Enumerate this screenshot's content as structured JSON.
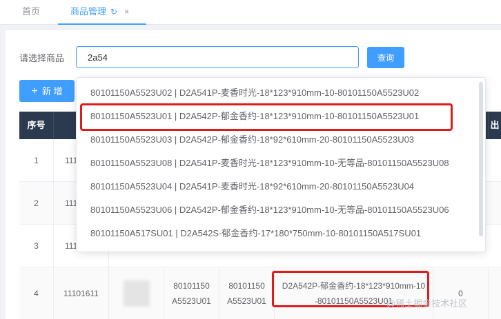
{
  "tabs": {
    "home": "首页",
    "active": "商品管理",
    "refresh_icon": "↻",
    "close_icon": "×"
  },
  "filter": {
    "label": "请选择商品",
    "value": "2a54",
    "query_button": "查询"
  },
  "toolbar": {
    "add_label": "新 增",
    "add_icon": "+"
  },
  "table": {
    "headers": [
      "序号",
      "",
      "",
      "",
      "",
      "",
      "",
      "出"
    ],
    "rows": [
      {
        "index": "1",
        "code": "111",
        "c1": "",
        "c2": "",
        "name": "",
        "qty": ""
      },
      {
        "index": "2",
        "code": "111",
        "c1": "",
        "c2": "",
        "name": "",
        "qty": ""
      },
      {
        "index": "3",
        "code": "111",
        "c1": "",
        "c2": "",
        "name": "",
        "qty": ""
      },
      {
        "index": "4",
        "code": "11101611",
        "c1": "80101150\nA5523U01",
        "c2": "80101150\nA5523U01",
        "name": "D2A542P-郁金香约-18*123*910mm-10\n-80101150A5523U01",
        "qty": "0"
      }
    ]
  },
  "dropdown": {
    "options": [
      "80101150A5523U02 | D2A541P-麦香时光-18*123*910mm-10-80101150A5523U02",
      "80101150A5523U01 | D2A542P-郁金香约-18*123*910mm-10-80101150A5523U01",
      "80101150A5523U03 | D2A542P-郁金香约-18*92*610mm-20-80101150A5523U03",
      "80101150A5523U08 | D2A541P-麦香时光-18*123*910mm-10-无等品-80101150A5523U08",
      "80101150A5523U04 | D2A541P-麦香时光-18*92*610mm-20-80101150A5523U04",
      "80101150A5523U06 | D2A542P-郁金香约-18*123*910mm-10-无等品-80101150A5523U06",
      "80101150A517SU01 | D2A542S-郁金香约-17*180*750mm-10-80101150A517SU01"
    ]
  },
  "watermark": "@稀土掘金技术社区",
  "colors": {
    "primary": "#409eff",
    "header_bg": "#2b3a4e",
    "highlight": "#e11a1a"
  }
}
